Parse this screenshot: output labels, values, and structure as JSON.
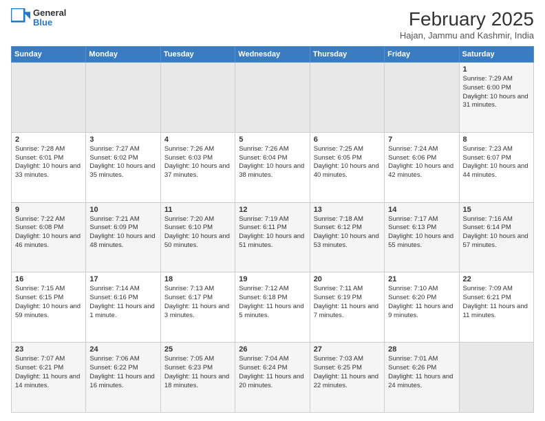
{
  "header": {
    "logo_general": "General",
    "logo_blue": "Blue",
    "month_title": "February 2025",
    "location": "Hajan, Jammu and Kashmir, India"
  },
  "weekdays": [
    "Sunday",
    "Monday",
    "Tuesday",
    "Wednesday",
    "Thursday",
    "Friday",
    "Saturday"
  ],
  "weeks": [
    [
      {
        "day": "",
        "info": ""
      },
      {
        "day": "",
        "info": ""
      },
      {
        "day": "",
        "info": ""
      },
      {
        "day": "",
        "info": ""
      },
      {
        "day": "",
        "info": ""
      },
      {
        "day": "",
        "info": ""
      },
      {
        "day": "1",
        "info": "Sunrise: 7:29 AM\nSunset: 6:00 PM\nDaylight: 10 hours and 31 minutes."
      }
    ],
    [
      {
        "day": "2",
        "info": "Sunrise: 7:28 AM\nSunset: 6:01 PM\nDaylight: 10 hours and 33 minutes."
      },
      {
        "day": "3",
        "info": "Sunrise: 7:27 AM\nSunset: 6:02 PM\nDaylight: 10 hours and 35 minutes."
      },
      {
        "day": "4",
        "info": "Sunrise: 7:26 AM\nSunset: 6:03 PM\nDaylight: 10 hours and 37 minutes."
      },
      {
        "day": "5",
        "info": "Sunrise: 7:26 AM\nSunset: 6:04 PM\nDaylight: 10 hours and 38 minutes."
      },
      {
        "day": "6",
        "info": "Sunrise: 7:25 AM\nSunset: 6:05 PM\nDaylight: 10 hours and 40 minutes."
      },
      {
        "day": "7",
        "info": "Sunrise: 7:24 AM\nSunset: 6:06 PM\nDaylight: 10 hours and 42 minutes."
      },
      {
        "day": "8",
        "info": "Sunrise: 7:23 AM\nSunset: 6:07 PM\nDaylight: 10 hours and 44 minutes."
      }
    ],
    [
      {
        "day": "9",
        "info": "Sunrise: 7:22 AM\nSunset: 6:08 PM\nDaylight: 10 hours and 46 minutes."
      },
      {
        "day": "10",
        "info": "Sunrise: 7:21 AM\nSunset: 6:09 PM\nDaylight: 10 hours and 48 minutes."
      },
      {
        "day": "11",
        "info": "Sunrise: 7:20 AM\nSunset: 6:10 PM\nDaylight: 10 hours and 50 minutes."
      },
      {
        "day": "12",
        "info": "Sunrise: 7:19 AM\nSunset: 6:11 PM\nDaylight: 10 hours and 51 minutes."
      },
      {
        "day": "13",
        "info": "Sunrise: 7:18 AM\nSunset: 6:12 PM\nDaylight: 10 hours and 53 minutes."
      },
      {
        "day": "14",
        "info": "Sunrise: 7:17 AM\nSunset: 6:13 PM\nDaylight: 10 hours and 55 minutes."
      },
      {
        "day": "15",
        "info": "Sunrise: 7:16 AM\nSunset: 6:14 PM\nDaylight: 10 hours and 57 minutes."
      }
    ],
    [
      {
        "day": "16",
        "info": "Sunrise: 7:15 AM\nSunset: 6:15 PM\nDaylight: 10 hours and 59 minutes."
      },
      {
        "day": "17",
        "info": "Sunrise: 7:14 AM\nSunset: 6:16 PM\nDaylight: 11 hours and 1 minute."
      },
      {
        "day": "18",
        "info": "Sunrise: 7:13 AM\nSunset: 6:17 PM\nDaylight: 11 hours and 3 minutes."
      },
      {
        "day": "19",
        "info": "Sunrise: 7:12 AM\nSunset: 6:18 PM\nDaylight: 11 hours and 5 minutes."
      },
      {
        "day": "20",
        "info": "Sunrise: 7:11 AM\nSunset: 6:19 PM\nDaylight: 11 hours and 7 minutes."
      },
      {
        "day": "21",
        "info": "Sunrise: 7:10 AM\nSunset: 6:20 PM\nDaylight: 11 hours and 9 minutes."
      },
      {
        "day": "22",
        "info": "Sunrise: 7:09 AM\nSunset: 6:21 PM\nDaylight: 11 hours and 11 minutes."
      }
    ],
    [
      {
        "day": "23",
        "info": "Sunrise: 7:07 AM\nSunset: 6:21 PM\nDaylight: 11 hours and 14 minutes."
      },
      {
        "day": "24",
        "info": "Sunrise: 7:06 AM\nSunset: 6:22 PM\nDaylight: 11 hours and 16 minutes."
      },
      {
        "day": "25",
        "info": "Sunrise: 7:05 AM\nSunset: 6:23 PM\nDaylight: 11 hours and 18 minutes."
      },
      {
        "day": "26",
        "info": "Sunrise: 7:04 AM\nSunset: 6:24 PM\nDaylight: 11 hours and 20 minutes."
      },
      {
        "day": "27",
        "info": "Sunrise: 7:03 AM\nSunset: 6:25 PM\nDaylight: 11 hours and 22 minutes."
      },
      {
        "day": "28",
        "info": "Sunrise: 7:01 AM\nSunset: 6:26 PM\nDaylight: 11 hours and 24 minutes."
      },
      {
        "day": "",
        "info": ""
      }
    ]
  ]
}
